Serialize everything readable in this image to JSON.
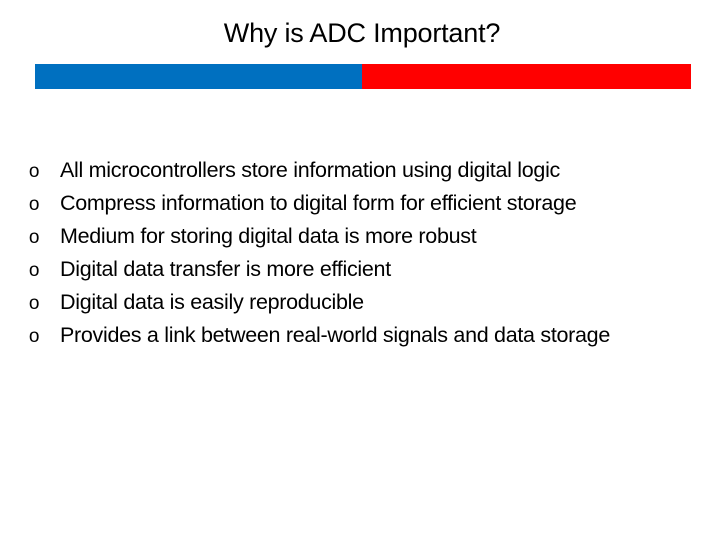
{
  "slide": {
    "title": "Why is ADC Important?",
    "accent_bar": {
      "left_color": "#0070C0",
      "right_color": "#FF0000"
    },
    "bullet_marker": "o",
    "bullets": [
      {
        "text": "All microcontrollers store information using digital logic"
      },
      {
        "text": "Compress information to digital form for efficient storage"
      },
      {
        "text": "Medium for storing digital data is more robust"
      },
      {
        "text": "Digital data transfer is more efficient"
      },
      {
        "text": "Digital data is easily reproducible"
      },
      {
        "text": "Provides a link between real-world signals and data storage"
      }
    ]
  }
}
